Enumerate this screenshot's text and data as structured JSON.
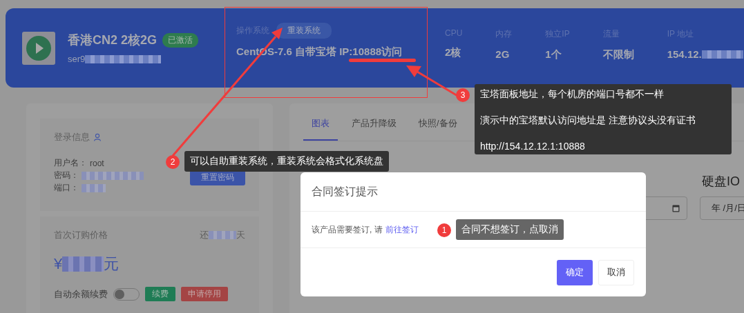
{
  "header": {
    "title": "香港CN2 2核2G",
    "status_badge": "已激活",
    "hostname_visible": "ser9",
    "os": {
      "label": "操作系统",
      "reinstall_button": "重装系统",
      "value": "CentOS-7.6 自带宝塔 IP:10888访问"
    },
    "stats": [
      {
        "label": "CPU",
        "value": "2核",
        "redacted": false
      },
      {
        "label": "内存",
        "value": "2G",
        "redacted": false
      },
      {
        "label": "独立IP",
        "value": "1个",
        "redacted": false
      },
      {
        "label": "流量",
        "value": "不限制",
        "redacted": false
      },
      {
        "label": "IP 地址",
        "value": "154.12.",
        "redacted": true
      }
    ]
  },
  "login_info": {
    "title": "登录信息",
    "fields": [
      {
        "label": "用户名：",
        "value": "root",
        "redacted": false
      },
      {
        "label": "密码：",
        "redacted": true
      },
      {
        "label": "端口：",
        "redacted": true
      }
    ],
    "reset_button": "重置密码"
  },
  "price": {
    "title": "首次订购价格",
    "remaining_prefix": "还",
    "remaining_suffix": "天",
    "currency": "¥",
    "unit": "元",
    "auto_renew": {
      "label": "自动余额续费",
      "checked": false
    },
    "renew_button": "续费",
    "stop_button": "申请停用"
  },
  "tabs": [
    {
      "label": "图表",
      "selected": true
    },
    {
      "label": "产品升降级",
      "selected": false
    },
    {
      "label": "快照/备份",
      "selected": false
    }
  ],
  "chart_heading": "硬盘IO",
  "date_inputs": [
    {
      "calendar_icon": true
    },
    {
      "value": "年 /月/日"
    }
  ],
  "dialog": {
    "title": "合同签订提示",
    "message": "该产品需要签订, 请",
    "link": "前往签订",
    "confirm_button": "确定",
    "cancel_button": "取消"
  },
  "annotations": [
    {
      "number": "1",
      "lines": [
        "合同不想签订，点取消"
      ]
    },
    {
      "number": "2",
      "lines": [
        "可以自助重装系统，重装系统会格式化系统盘"
      ]
    },
    {
      "number": "3",
      "lines": [
        "宝塔面板地址，每个机房的端口号都不一样",
        "演示中的宝塔默认访问地址是 注意协议头没有证书",
        "http://154.12.12.1:10888"
      ]
    }
  ]
}
